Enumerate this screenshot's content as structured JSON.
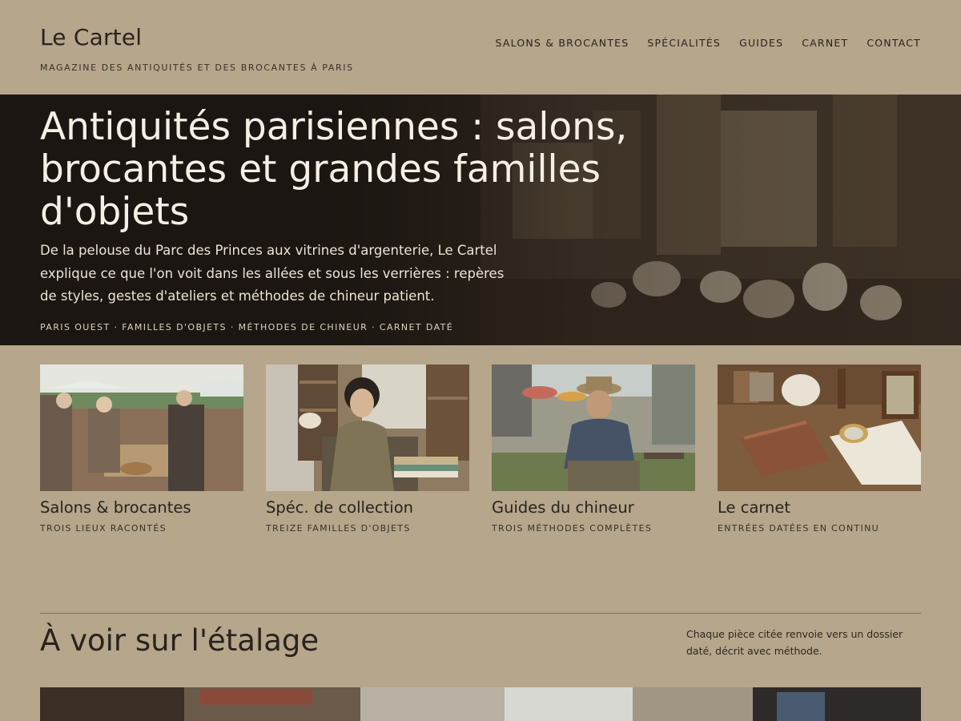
{
  "site": {
    "title": "Le Cartel",
    "tagline": "MAGAZINE DES ANTIQUITÉS ET DES BROCANTES À PARIS"
  },
  "nav": {
    "items": [
      {
        "label": "SALONS & BROCANTES"
      },
      {
        "label": "SPÉCIALITÉS"
      },
      {
        "label": "GUIDES"
      },
      {
        "label": "CARNET"
      },
      {
        "label": "CONTACT"
      }
    ]
  },
  "hero": {
    "title": "Antiquités parisiennes : salons, brocantes et grandes familles d'objets",
    "description": "De la pelouse du Parc des Princes aux vitrines d'argenterie, Le Cartel explique ce que l'on voit dans les allées et sous les verrières : repères de styles, gestes d'ateliers et méthodes de chineur patient.",
    "tags": "PARIS OUEST · FAMILLES D'OBJETS · MÉTHODES DE CHINEUR · CARNET DATÉ"
  },
  "cards": [
    {
      "title": "Salons & brocantes",
      "subtitle": "TROIS LIEUX RACONTÉS"
    },
    {
      "title": "Spéc. de collection",
      "subtitle": "TREIZE FAMILLES D'OBJETS"
    },
    {
      "title": "Guides du chineur",
      "subtitle": "TROIS MÉTHODES COMPLÈTES"
    },
    {
      "title": "Le carnet",
      "subtitle": "ENTRÉES DATÉES EN CONTINU"
    }
  ],
  "section": {
    "title": "À voir sur l'étalage",
    "note": "Chaque pièce citée renvoie vers un dossier daté, décrit avec méthode."
  },
  "colors": {
    "background": "#b5a68c",
    "text": "#2a231c",
    "hero_text": "#f5efe5"
  }
}
